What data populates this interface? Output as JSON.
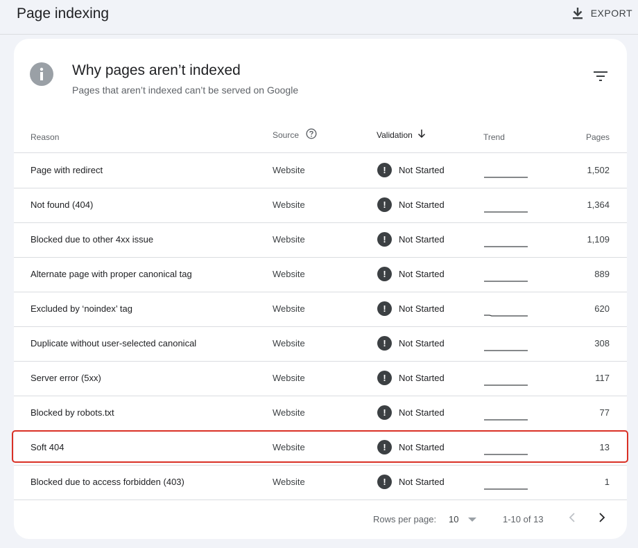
{
  "header": {
    "title": "Page indexing",
    "export_label": "EXPORT"
  },
  "card": {
    "title": "Why pages aren’t indexed",
    "subtitle": "Pages that aren’t indexed can’t be served on Google"
  },
  "table": {
    "columns": {
      "reason": "Reason",
      "source": "Source",
      "validation": "Validation",
      "trend": "Trend",
      "pages": "Pages"
    },
    "rows": [
      {
        "reason": "Page with redirect",
        "source": "Website",
        "validation": "Not Started",
        "pages": "1,502"
      },
      {
        "reason": "Not found (404)",
        "source": "Website",
        "validation": "Not Started",
        "pages": "1,364"
      },
      {
        "reason": "Blocked due to other 4xx issue",
        "source": "Website",
        "validation": "Not Started",
        "pages": "1,109"
      },
      {
        "reason": "Alternate page with proper canonical tag",
        "source": "Website",
        "validation": "Not Started",
        "pages": "889"
      },
      {
        "reason": "Excluded by ‘noindex’ tag",
        "source": "Website",
        "validation": "Not Started",
        "pages": "620"
      },
      {
        "reason": "Duplicate without user-selected canonical",
        "source": "Website",
        "validation": "Not Started",
        "pages": "308"
      },
      {
        "reason": "Server error (5xx)",
        "source": "Website",
        "validation": "Not Started",
        "pages": "117"
      },
      {
        "reason": "Blocked by robots.txt",
        "source": "Website",
        "validation": "Not Started",
        "pages": "77"
      },
      {
        "reason": "Soft 404",
        "source": "Website",
        "validation": "Not Started",
        "pages": "13"
      },
      {
        "reason": "Blocked due to access forbidden (403)",
        "source": "Website",
        "validation": "Not Started",
        "pages": "1"
      }
    ],
    "highlighted_row": "Soft 404"
  },
  "pagination": {
    "rows_per_page_label": "Rows per page:",
    "rows_per_page_value": "10",
    "range_text": "1-10 of 13"
  },
  "colors": {
    "highlight": "#d93025",
    "status_icon": "#3c4043",
    "info_icon": "#9aa0a6"
  },
  "icons": {
    "export": "download-icon",
    "info": "info-icon",
    "filter": "filter-icon",
    "help": "help-circle-icon",
    "sort": "arrow-down-icon",
    "status": "exclamation-circle-icon",
    "dropdown": "caret-down-icon",
    "prev": "chevron-left-icon",
    "next": "chevron-right-icon"
  }
}
